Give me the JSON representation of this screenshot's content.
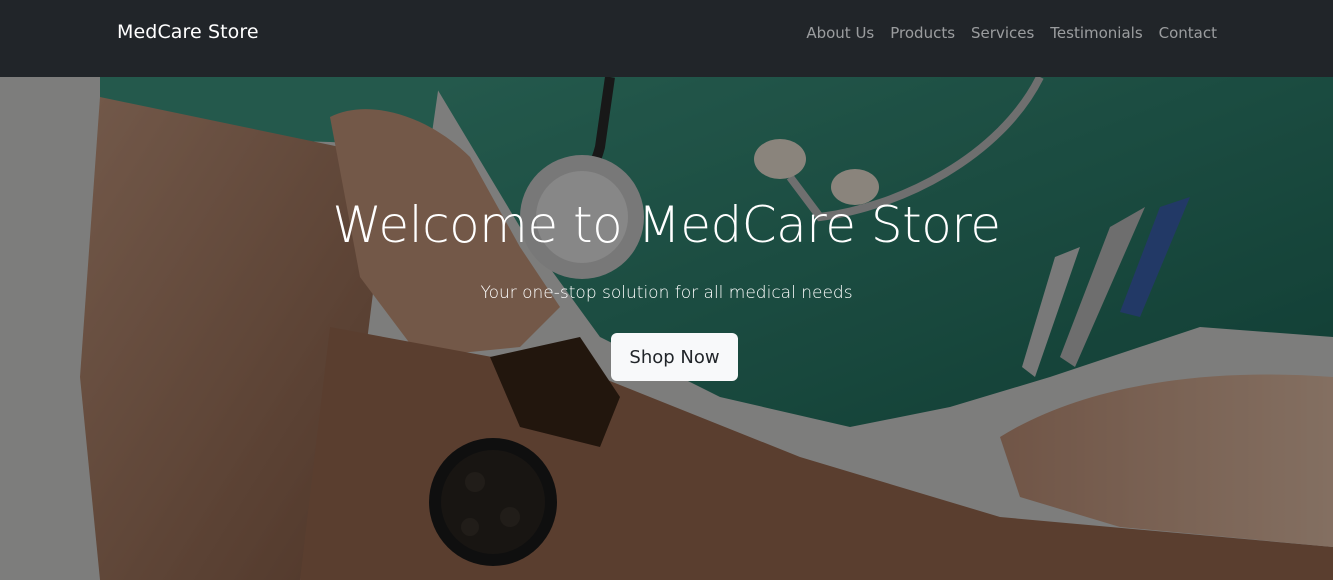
{
  "navbar": {
    "brand": "MedCare Store",
    "links": [
      {
        "label": "About Us"
      },
      {
        "label": "Products"
      },
      {
        "label": "Services"
      },
      {
        "label": "Testimonials"
      },
      {
        "label": "Contact"
      }
    ]
  },
  "hero": {
    "title": "Welcome to MedCare Store",
    "subtitle": "Your one-stop solution for all medical needs",
    "cta_label": "Shop Now",
    "background_image": "doctor-in-scrubs-with-stethoscope-and-watch"
  },
  "colors": {
    "navbar_bg": "#212529",
    "text_light": "#ffffff",
    "nav_link": "rgba(255,255,255,0.55)",
    "button_bg": "#f8f9fa",
    "button_text": "#212529",
    "scrubs": "#2a7a6a"
  }
}
